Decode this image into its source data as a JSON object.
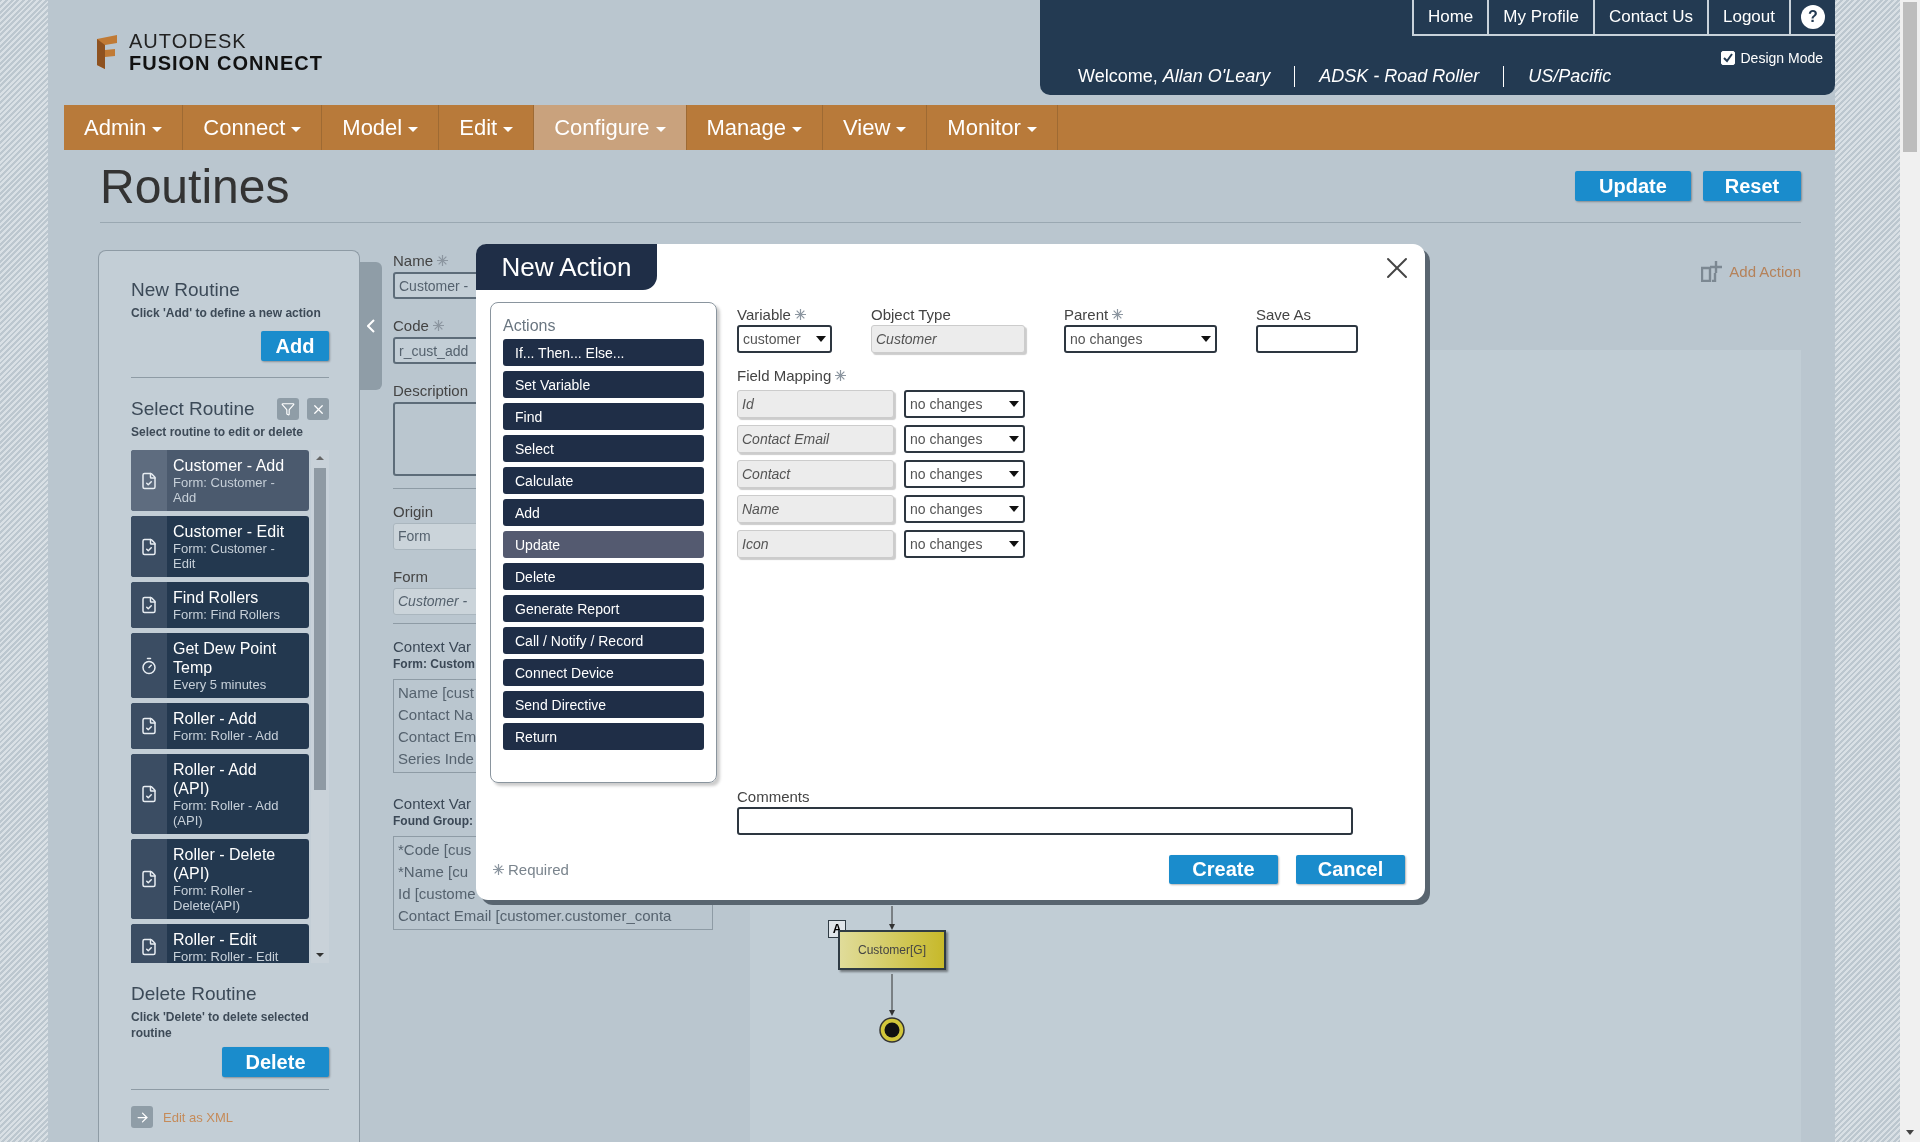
{
  "logo": {
    "brand": "AUTODESK",
    "product": "FUSION CONNECT"
  },
  "top_links": [
    {
      "label": "Home",
      "kind": "text"
    },
    {
      "label": "My Profile",
      "kind": "text"
    },
    {
      "label": "Contact Us",
      "kind": "text"
    },
    {
      "label": "Logout",
      "kind": "text"
    },
    {
      "label": "?",
      "kind": "help"
    }
  ],
  "design_mode": {
    "label": "Design Mode",
    "checked": true
  },
  "user_bar": {
    "welcome": "Welcome,",
    "user": "Allan O'Leary",
    "account": "ADSK - Road Roller",
    "timezone": "US/Pacific"
  },
  "nav": [
    {
      "label": "Admin",
      "selected": false
    },
    {
      "label": "Connect",
      "selected": false
    },
    {
      "label": "Model",
      "selected": false
    },
    {
      "label": "Edit",
      "selected": false
    },
    {
      "label": "Configure",
      "selected": true
    },
    {
      "label": "Manage",
      "selected": false
    },
    {
      "label": "View",
      "selected": false
    },
    {
      "label": "Monitor",
      "selected": false
    }
  ],
  "page_title": "Routines",
  "page_buttons": [
    "Update",
    "Reset"
  ],
  "sidebar": {
    "new_routine": {
      "title": "New Routine",
      "hint": "Click 'Add' to define a new action",
      "button": "Add"
    },
    "select_routine": {
      "title": "Select Routine",
      "hint": "Select routine to edit or delete",
      "items": [
        {
          "name": "Customer - Add",
          "detail": "Form: Customer - Add",
          "kind": "form",
          "selected": true
        },
        {
          "name": "Customer - Edit",
          "detail": "Form: Customer - Edit",
          "kind": "form",
          "selected": false
        },
        {
          "name": "Find Rollers",
          "detail": "Form: Find Rollers",
          "kind": "form",
          "selected": false
        },
        {
          "name": "Get Dew Point Temp",
          "detail": "Every 5 minutes",
          "kind": "timer",
          "selected": false
        },
        {
          "name": "Roller - Add",
          "detail": "Form: Roller - Add",
          "kind": "form",
          "selected": false
        },
        {
          "name": "Roller - Add (API)",
          "detail": "Form: Roller - Add (API)",
          "kind": "form",
          "selected": false
        },
        {
          "name": "Roller - Delete (API)",
          "detail": "Form: Roller - Delete(API)",
          "kind": "form",
          "selected": false
        },
        {
          "name": "Roller - Edit",
          "detail": "Form: Roller - Edit",
          "kind": "form",
          "selected": false
        }
      ]
    },
    "delete_routine": {
      "title": "Delete Routine",
      "hint": "Click 'Delete' to delete selected routine",
      "button": "Delete"
    },
    "xml_link": "Edit as XML"
  },
  "routine_form": {
    "fields": [
      {
        "kind": "input",
        "label": "Name",
        "required": true,
        "value": "Customer -"
      },
      {
        "kind": "input",
        "label": "Code",
        "required": true,
        "value": "r_cust_add"
      },
      {
        "kind": "textarea",
        "label": "Description",
        "required": false
      },
      {
        "kind": "readonly",
        "label": "Origin",
        "required": false,
        "value": "Form"
      },
      {
        "kind": "select",
        "label": "Form",
        "required": false,
        "value": "Customer -"
      }
    ],
    "context_lists": [
      {
        "label": "Context Var",
        "sub": "Form: Custom",
        "lines": [
          "Name [cust",
          "Contact Na",
          "Contact Em",
          "Series Inde"
        ]
      },
      {
        "label": "Context Var",
        "sub": "Found Group:",
        "lines": [
          "*Code [cus",
          "*Name [cu",
          "Id [custome",
          "Contact Email [customer.customer_conta"
        ]
      }
    ]
  },
  "canvas": {
    "add_action": "Add Action",
    "node": {
      "tag": "A",
      "label": "Customer[G]"
    }
  },
  "modal": {
    "title": "New Action",
    "actions_label": "Actions",
    "actions": [
      {
        "label": "If... Then... Else...",
        "selected": false
      },
      {
        "label": "Set Variable",
        "selected": false
      },
      {
        "label": "Find",
        "selected": false
      },
      {
        "label": "Select",
        "selected": false
      },
      {
        "label": "Calculate",
        "selected": false
      },
      {
        "label": "Add",
        "selected": false
      },
      {
        "label": "Update",
        "selected": true
      },
      {
        "label": "Delete",
        "selected": false
      },
      {
        "label": "Generate Report",
        "selected": false
      },
      {
        "label": "Call / Notify / Record",
        "selected": false
      },
      {
        "label": "Connect Device",
        "selected": false
      },
      {
        "label": "Send Directive",
        "selected": false
      },
      {
        "label": "Return",
        "selected": false
      }
    ],
    "top_fields": [
      {
        "kind": "select",
        "label": "Variable",
        "required": true,
        "value": "customer"
      },
      {
        "kind": "readonly",
        "label": "Object Type",
        "required": false,
        "value": "Customer"
      },
      {
        "kind": "select",
        "label": "Parent",
        "required": true,
        "value": "no changes"
      },
      {
        "kind": "input",
        "label": "Save As",
        "required": false
      }
    ],
    "field_mapping": {
      "label": "Field Mapping",
      "required": true,
      "rows": [
        {
          "field": "Id",
          "value": "no changes"
        },
        {
          "field": "Contact Email",
          "value": "no changes"
        },
        {
          "field": "Contact",
          "value": "no changes"
        },
        {
          "field": "Name",
          "value": "no changes"
        },
        {
          "field": "Icon",
          "value": "no changes"
        }
      ]
    },
    "comments": {
      "label": "Comments"
    },
    "required_note": "Required",
    "buttons": [
      "Create",
      "Cancel"
    ]
  }
}
